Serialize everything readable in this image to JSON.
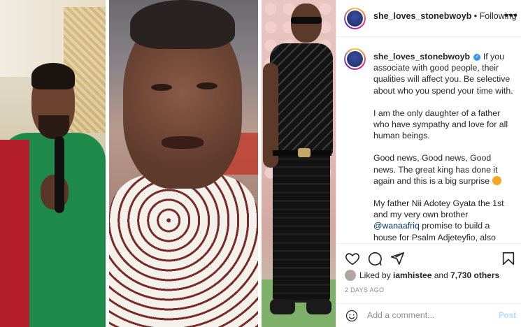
{
  "header": {
    "username": "she_loves_stonebwoyb",
    "separator": " • ",
    "follow_status": "Following",
    "more_icon": "more-horizontal-icon"
  },
  "caption": {
    "username": "she_loves_stonebwoyb",
    "paragraphs": [
      "If you associate with good people, their qualities will affect you. Be selective about who you spend your time with.",
      "I am the only daughter of a father who have sympathy and love for all human beings.",
      "Good news, Good news, Good news. The great king has done it again and this is a big surprise",
      "My father Nii Adotey Gyata the 1st and my very own brother",
      "promise to build a house for Psalm Adjeteyfio, also known as T.T, a veteran Ghanaian actor. God protect and guide this kind souls, whatever they spend on this project turn"
    ],
    "mention": "@wanaafriq"
  },
  "actions": {
    "icons": [
      "heart-icon",
      "comment-icon",
      "share-icon",
      "bookmark-icon"
    ]
  },
  "likes": {
    "prefix": "Liked by",
    "user": "iamhistee",
    "joiner": "and",
    "others": "7,730 others"
  },
  "timestamp": "2 DAYS AGO",
  "comment": {
    "placeholder": "Add a comment...",
    "post_label": "Post"
  },
  "colors": {
    "link": "#00376b",
    "verified": "#3897f0",
    "post_disabled": "#b3dbff",
    "muted": "#8e8e8e"
  }
}
